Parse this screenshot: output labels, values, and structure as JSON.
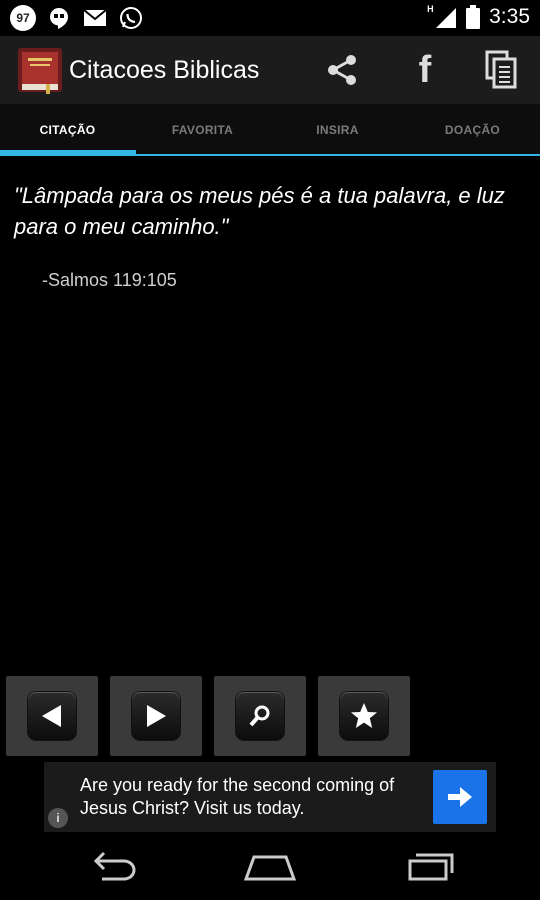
{
  "status_bar": {
    "badge_count": "97",
    "signal_label": "H",
    "time": "3:35"
  },
  "action_bar": {
    "title": "Citacoes Biblicas",
    "share_icon": "share-icon",
    "facebook_label": "f",
    "copy_icon": "copy-icon"
  },
  "tabs": [
    {
      "label": "CITAÇÃO",
      "active": true
    },
    {
      "label": "FAVORITA",
      "active": false
    },
    {
      "label": "INSIRA",
      "active": false
    },
    {
      "label": "DOAÇÃO",
      "active": false
    }
  ],
  "quote": {
    "text": "\"Lâmpada para os meus pés é a tua palavra, e luz para o meu caminho.\"",
    "reference": "-Salmos 119:105"
  },
  "controls": [
    {
      "name": "previous",
      "icon": "triangle-left-icon"
    },
    {
      "name": "next",
      "icon": "triangle-right-icon"
    },
    {
      "name": "search",
      "icon": "search-icon"
    },
    {
      "name": "favorite",
      "icon": "star-icon"
    }
  ],
  "ad": {
    "text": "Are you ready for the second coming of Jesus Christ? Visit us today.",
    "info_label": "i"
  },
  "colors": {
    "accent": "#33b5e5",
    "ad_button": "#1a73e8"
  }
}
